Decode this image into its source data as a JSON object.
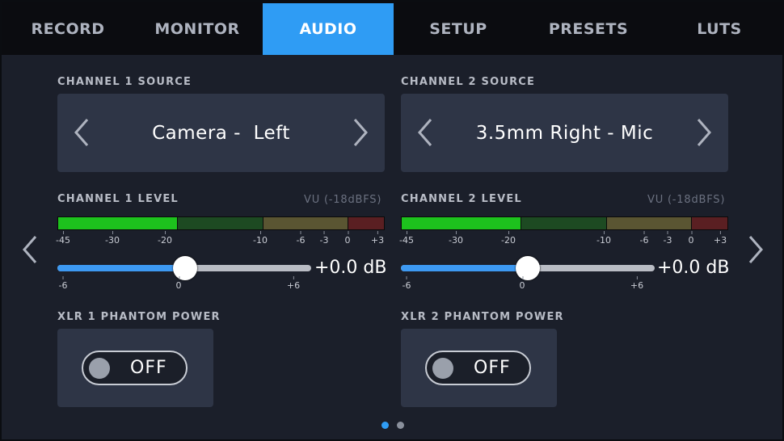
{
  "tabs": [
    {
      "label": "RECORD"
    },
    {
      "label": "MONITOR"
    },
    {
      "label": "AUDIO",
      "active": true
    },
    {
      "label": "SETUP"
    },
    {
      "label": "PRESETS"
    },
    {
      "label": "LUTS"
    }
  ],
  "channel1": {
    "source_label": "CHANNEL 1 SOURCE",
    "source_value": "Camera -  Left",
    "level_label": "CHANNEL 1 LEVEL",
    "vu_label": "VU (-18dBFS)",
    "meter_scale": [
      "-45",
      "-30",
      "-20",
      "-10",
      "-6",
      "-3",
      "0",
      "+3"
    ],
    "slider_scale": [
      "-6",
      "0",
      "+6"
    ],
    "gain_value": "+0.0 dB",
    "phantom_label": "XLR 1 PHANTOM POWER",
    "phantom_state": "OFF"
  },
  "channel2": {
    "source_label": "CHANNEL 2 SOURCE",
    "source_value": "3.5mm Right - Mic",
    "level_label": "CHANNEL 2 LEVEL",
    "vu_label": "VU (-18dBFS)",
    "meter_scale": [
      "-45",
      "-30",
      "-20",
      "-10",
      "-6",
      "-3",
      "0",
      "+3"
    ],
    "slider_scale": [
      "-6",
      "0",
      "+6"
    ],
    "gain_value": "+0.0 dB",
    "phantom_label": "XLR 2 PHANTOM POWER",
    "phantom_state": "OFF"
  },
  "colors": {
    "accent": "#2f9cf4",
    "meter_green": "#1dc21d",
    "meter_dark_green": "#1d4a22",
    "meter_olive": "#5a5532",
    "meter_red": "#5a1f22"
  },
  "icons": {
    "prev": "chevron-left-icon",
    "next": "chevron-right-icon"
  },
  "pagination": {
    "pages": 2,
    "current": 1
  }
}
